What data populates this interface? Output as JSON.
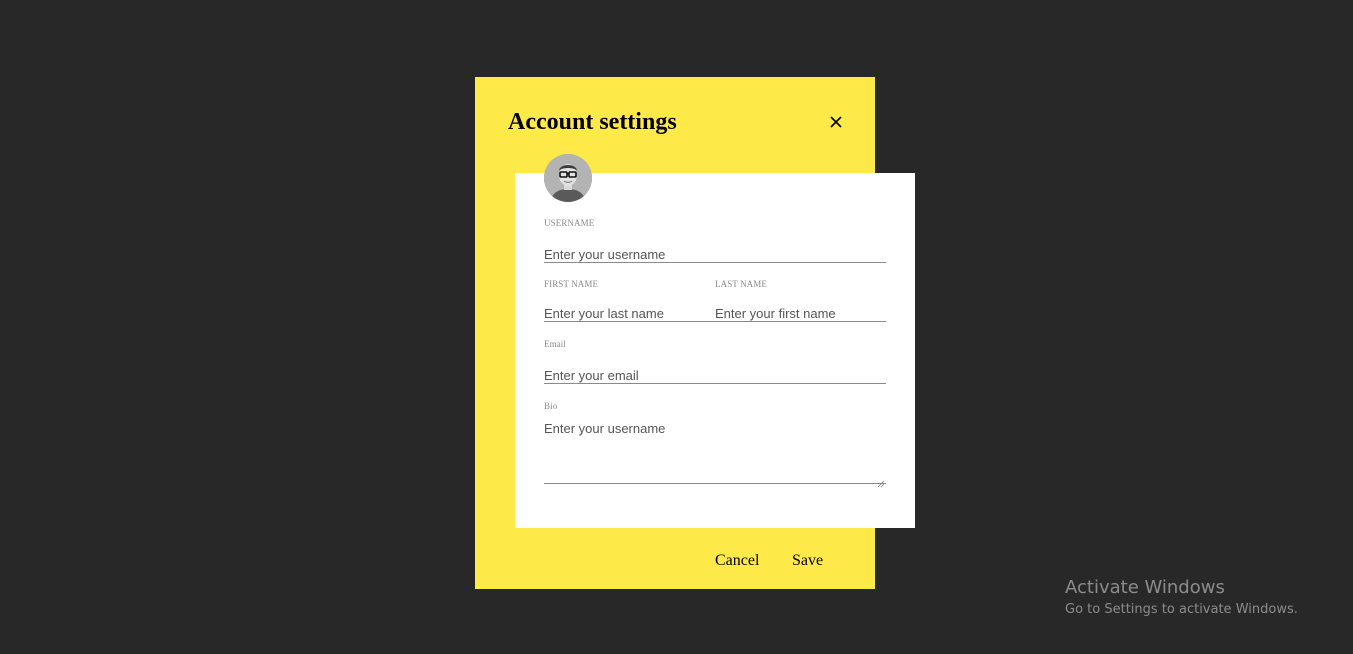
{
  "dialog": {
    "title": "Account settings",
    "close_icon": "close-icon",
    "background": "#fdea49"
  },
  "profile": {
    "avatar_icon": "user-avatar-photo"
  },
  "form": {
    "username": {
      "label": "USERNAME",
      "placeholder": "Enter your username",
      "value": ""
    },
    "first_name": {
      "label": "FIRST NAME",
      "placeholder": "Enter your last name",
      "value": ""
    },
    "last_name": {
      "label": "LAST NAME",
      "placeholder": "Enter your first name",
      "value": ""
    },
    "email": {
      "label": "Email",
      "placeholder": "Enter your email",
      "value": ""
    },
    "bio": {
      "label": "Bio",
      "placeholder": "Enter your username",
      "value": ""
    }
  },
  "actions": {
    "cancel_label": "Cancel",
    "save_label": "Save"
  },
  "watermark": {
    "title": "Activate Windows",
    "subtitle": "Go to Settings to activate Windows."
  },
  "colors": {
    "page_background": "#282828",
    "card_background": "#ffffff",
    "watermark_text": "#8c8c8c"
  }
}
